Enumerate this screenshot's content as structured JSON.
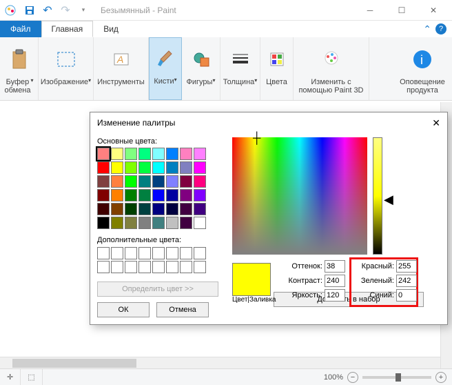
{
  "window": {
    "title": "Безымянный - Paint"
  },
  "tabs": {
    "file": "Файл",
    "main": "Главная",
    "view": "Вид"
  },
  "ribbon": {
    "clipboard": "Буфер\nобмена",
    "image": "Изображение",
    "tools": "Инструменты",
    "brushes": "Кисти",
    "shapes": "Фигуры",
    "thickness": "Толщина",
    "colors": "Цвета",
    "edit3d": "Изменить с\nпомощью Paint 3D",
    "notify": "Оповещение\nпродукта"
  },
  "status": {
    "zoom_value": "100%"
  },
  "dialog": {
    "title": "Изменение палитры",
    "basic_label": "Основные цвета:",
    "custom_label": "Дополнительные цвета:",
    "define_btn": "Определить цвет >>",
    "ok": "ОК",
    "cancel": "Отмена",
    "color_fill": "Цвет|Заливка",
    "hue_l": "Оттенок:",
    "hue_v": "38",
    "sat_l": "Контраст:",
    "sat_v": "240",
    "lum_l": "Яркость:",
    "lum_v": "120",
    "r_l": "Красный:",
    "r_v": "255",
    "g_l": "Зеленый:",
    "g_v": "242",
    "b_l": "Синий:",
    "b_v": "0",
    "add_btn": "Добавить в набор",
    "basic_colors": [
      "#ff8080",
      "#ffff80",
      "#80ff80",
      "#00ff80",
      "#80ffff",
      "#0080ff",
      "#ff80c0",
      "#ff80ff",
      "#ff0000",
      "#ffff00",
      "#80ff00",
      "#00ff40",
      "#00ffff",
      "#0080c0",
      "#8080c0",
      "#ff00ff",
      "#804040",
      "#ff8040",
      "#00ff00",
      "#008080",
      "#004080",
      "#8080ff",
      "#800040",
      "#ff0080",
      "#800000",
      "#ff8000",
      "#008000",
      "#008040",
      "#0000ff",
      "#0000a0",
      "#800080",
      "#8000ff",
      "#400000",
      "#804000",
      "#004000",
      "#004040",
      "#000080",
      "#000040",
      "#400040",
      "#400080",
      "#000000",
      "#808000",
      "#808040",
      "#808080",
      "#408080",
      "#c0c0c0",
      "#400040",
      "#ffffff"
    ]
  }
}
